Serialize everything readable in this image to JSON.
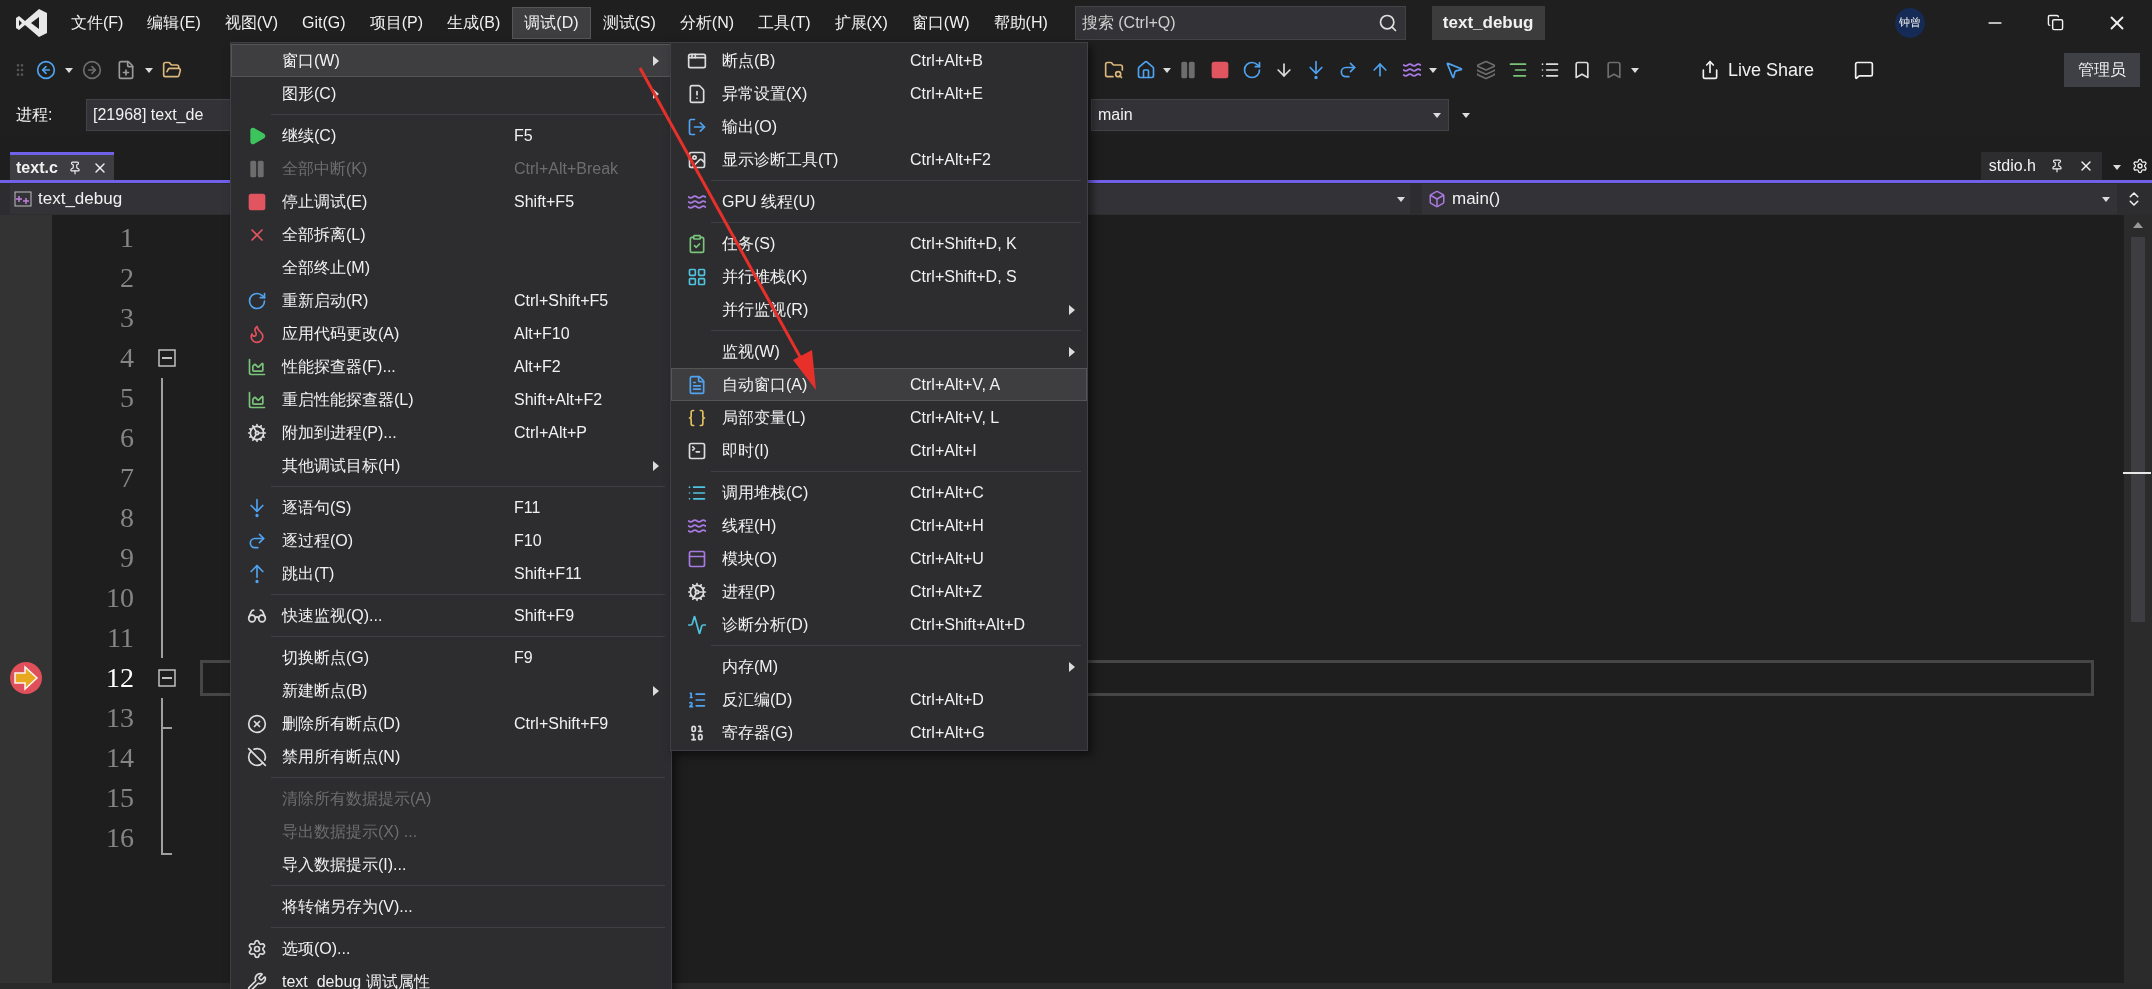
{
  "title_bar": {
    "menu": [
      {
        "label": "文件(F)",
        "selected": false
      },
      {
        "label": "编辑(E)",
        "selected": false
      },
      {
        "label": "视图(V)",
        "selected": false
      },
      {
        "label": "Git(G)",
        "selected": false
      },
      {
        "label": "项目(P)",
        "selected": false
      },
      {
        "label": "生成(B)",
        "selected": false
      },
      {
        "label": "调试(D)",
        "selected": true
      },
      {
        "label": "测试(S)",
        "selected": false
      },
      {
        "label": "分析(N)",
        "selected": false
      },
      {
        "label": "工具(T)",
        "selected": false
      },
      {
        "label": "扩展(X)",
        "selected": false
      },
      {
        "label": "窗口(W)",
        "selected": false
      },
      {
        "label": "帮助(H)",
        "selected": false
      }
    ],
    "search": {
      "placeholder": "搜索 (Ctrl+Q)"
    },
    "solution_name": "text_debug",
    "user_avatar": "钟曾"
  },
  "toolbar": {
    "live_share": "Live Share",
    "admin_button": "管理员"
  },
  "process_bar": {
    "label": "进程:",
    "process": "[21968] text_de",
    "function_combo": "main"
  },
  "tabs": [
    {
      "label": "text.c",
      "selected": true
    }
  ],
  "right_tabs": [
    {
      "label": "stdio.h",
      "selected": false
    }
  ],
  "nav_bar": {
    "project": "text_debug",
    "member": "main()"
  },
  "editor": {
    "lines": [
      {
        "number": "1",
        "current": false,
        "kind": "plain"
      },
      {
        "number": "2",
        "current": false,
        "kind": "plain"
      },
      {
        "number": "3",
        "current": false,
        "kind": "plain"
      },
      {
        "number": "4",
        "current": false,
        "kind": "start"
      },
      {
        "number": "5",
        "current": false,
        "kind": "body"
      },
      {
        "number": "6",
        "current": false,
        "kind": "body"
      },
      {
        "number": "7",
        "current": false,
        "kind": "body"
      },
      {
        "number": "8",
        "current": false,
        "kind": "body"
      },
      {
        "number": "9",
        "current": false,
        "kind": "body"
      },
      {
        "number": "10",
        "current": false,
        "kind": "body"
      },
      {
        "number": "11",
        "current": false,
        "kind": "body"
      },
      {
        "number": "12",
        "current": true,
        "kind": "start"
      },
      {
        "number": "13",
        "current": false,
        "kind": "branch"
      },
      {
        "number": "14",
        "current": false,
        "kind": "body"
      },
      {
        "number": "15",
        "current": false,
        "kind": "body"
      },
      {
        "number": "16",
        "current": false,
        "kind": "end"
      }
    ]
  },
  "debug_menu": {
    "items": [
      {
        "kind": "item",
        "label": "窗口(W)",
        "submenu": true,
        "selected": true,
        "disabled": false
      },
      {
        "kind": "item",
        "label": "图形(C)",
        "submenu": true,
        "selected": false,
        "disabled": false
      },
      {
        "kind": "separator"
      },
      {
        "kind": "item",
        "label": "继续(C)",
        "shortcut": "F5",
        "submenu": false,
        "selected": false,
        "disabled": false
      },
      {
        "kind": "item",
        "label": "全部中断(K)",
        "shortcut": "Ctrl+Alt+Break",
        "submenu": false,
        "selected": false,
        "disabled": true
      },
      {
        "kind": "item",
        "label": "停止调试(E)",
        "shortcut": "Shift+F5",
        "submenu": false,
        "selected": false,
        "disabled": false
      },
      {
        "kind": "item",
        "label": "全部拆离(L)",
        "submenu": false,
        "selected": false,
        "disabled": false
      },
      {
        "kind": "item",
        "label": "全部终止(M)",
        "submenu": false,
        "selected": false,
        "disabled": false
      },
      {
        "kind": "item",
        "label": "重新启动(R)",
        "shortcut": "Ctrl+Shift+F5",
        "submenu": false,
        "selected": false,
        "disabled": false
      },
      {
        "kind": "item",
        "label": "应用代码更改(A)",
        "shortcut": "Alt+F10",
        "submenu": false,
        "selected": false,
        "disabled": false
      },
      {
        "kind": "item",
        "label": "性能探查器(F)...",
        "shortcut": "Alt+F2",
        "submenu": false,
        "selected": false,
        "disabled": false
      },
      {
        "kind": "item",
        "label": "重启性能探查器(L)",
        "shortcut": "Shift+Alt+F2",
        "submenu": false,
        "selected": false,
        "disabled": false
      },
      {
        "kind": "item",
        "label": "附加到进程(P)...",
        "shortcut": "Ctrl+Alt+P",
        "submenu": false,
        "selected": false,
        "disabled": false
      },
      {
        "kind": "item",
        "label": "其他调试目标(H)",
        "submenu": true,
        "selected": false,
        "disabled": false
      },
      {
        "kind": "separator"
      },
      {
        "kind": "item",
        "label": "逐语句(S)",
        "shortcut": "F11",
        "submenu": false,
        "selected": false,
        "disabled": false
      },
      {
        "kind": "item",
        "label": "逐过程(O)",
        "shortcut": "F10",
        "submenu": false,
        "selected": false,
        "disabled": false
      },
      {
        "kind": "item",
        "label": "跳出(T)",
        "shortcut": "Shift+F11",
        "submenu": false,
        "selected": false,
        "disabled": false
      },
      {
        "kind": "separator"
      },
      {
        "kind": "item",
        "label": "快速监视(Q)...",
        "shortcut": "Shift+F9",
        "submenu": false,
        "selected": false,
        "disabled": false
      },
      {
        "kind": "separator"
      },
      {
        "kind": "item",
        "label": "切换断点(G)",
        "shortcut": "F9",
        "submenu": false,
        "selected": false,
        "disabled": false
      },
      {
        "kind": "item",
        "label": "新建断点(B)",
        "submenu": true,
        "selected": false,
        "disabled": false
      },
      {
        "kind": "item",
        "label": "删除所有断点(D)",
        "shortcut": "Ctrl+Shift+F9",
        "submenu": false,
        "selected": false,
        "disabled": false
      },
      {
        "kind": "item",
        "label": "禁用所有断点(N)",
        "submenu": false,
        "selected": false,
        "disabled": false
      },
      {
        "kind": "separator"
      },
      {
        "kind": "item",
        "label": "清除所有数据提示(A)",
        "submenu": false,
        "selected": false,
        "disabled": true
      },
      {
        "kind": "item",
        "label": "导出数据提示(X) ...",
        "submenu": false,
        "selected": false,
        "disabled": true
      },
      {
        "kind": "item",
        "label": "导入数据提示(I)...",
        "submenu": false,
        "selected": false,
        "disabled": false
      },
      {
        "kind": "separator"
      },
      {
        "kind": "item",
        "label": "将转储另存为(V)...",
        "submenu": false,
        "selected": false,
        "disabled": false
      },
      {
        "kind": "separator"
      },
      {
        "kind": "item",
        "label": "选项(O)...",
        "submenu": false,
        "selected": false,
        "disabled": false
      },
      {
        "kind": "item",
        "label": "text_debug 调试属性",
        "submenu": false,
        "selected": false,
        "disabled": false
      }
    ]
  },
  "window_submenu": {
    "items": [
      {
        "kind": "item",
        "label": "断点(B)",
        "shortcut": "Ctrl+Alt+B",
        "submenu": false,
        "selected": false
      },
      {
        "kind": "item",
        "label": "异常设置(X)",
        "shortcut": "Ctrl+Alt+E",
        "submenu": false,
        "selected": false
      },
      {
        "kind": "item",
        "label": "输出(O)",
        "submenu": false,
        "selected": false
      },
      {
        "kind": "item",
        "label": "显示诊断工具(T)",
        "shortcut": "Ctrl+Alt+F2",
        "submenu": false,
        "selected": false
      },
      {
        "kind": "separator"
      },
      {
        "kind": "item",
        "label": "GPU 线程(U)",
        "submenu": false,
        "selected": false
      },
      {
        "kind": "separator"
      },
      {
        "kind": "item",
        "label": "任务(S)",
        "shortcut": "Ctrl+Shift+D, K",
        "submenu": false,
        "selected": false
      },
      {
        "kind": "item",
        "label": "并行堆栈(K)",
        "shortcut": "Ctrl+Shift+D, S",
        "submenu": false,
        "selected": false
      },
      {
        "kind": "item",
        "label": "并行监视(R)",
        "submenu": true,
        "selected": false
      },
      {
        "kind": "separator"
      },
      {
        "kind": "item",
        "label": "监视(W)",
        "submenu": true,
        "selected": false
      },
      {
        "kind": "item",
        "label": "自动窗口(A)",
        "shortcut": "Ctrl+Alt+V, A",
        "submenu": false,
        "selected": true
      },
      {
        "kind": "item",
        "label": "局部变量(L)",
        "shortcut": "Ctrl+Alt+V, L",
        "submenu": false,
        "selected": false
      },
      {
        "kind": "item",
        "label": "即时(I)",
        "shortcut": "Ctrl+Alt+I",
        "submenu": false,
        "selected": false
      },
      {
        "kind": "separator"
      },
      {
        "kind": "item",
        "label": "调用堆栈(C)",
        "shortcut": "Ctrl+Alt+C",
        "submenu": false,
        "selected": false
      },
      {
        "kind": "item",
        "label": "线程(H)",
        "shortcut": "Ctrl+Alt+H",
        "submenu": false,
        "selected": false
      },
      {
        "kind": "item",
        "label": "模块(O)",
        "shortcut": "Ctrl+Alt+U",
        "submenu": false,
        "selected": false
      },
      {
        "kind": "item",
        "label": "进程(P)",
        "shortcut": "Ctrl+Alt+Z",
        "submenu": false,
        "selected": false
      },
      {
        "kind": "item",
        "label": "诊断分析(D)",
        "shortcut": "Ctrl+Shift+Alt+D",
        "submenu": false,
        "selected": false
      },
      {
        "kind": "separator"
      },
      {
        "kind": "item",
        "label": "内存(M)",
        "submenu": true,
        "selected": false
      },
      {
        "kind": "item",
        "label": "反汇编(D)",
        "shortcut": "Ctrl+Alt+D",
        "submenu": false,
        "selected": false
      },
      {
        "kind": "item",
        "label": "寄存器(G)",
        "shortcut": "Ctrl+Alt+G",
        "submenu": false,
        "selected": false
      }
    ]
  }
}
